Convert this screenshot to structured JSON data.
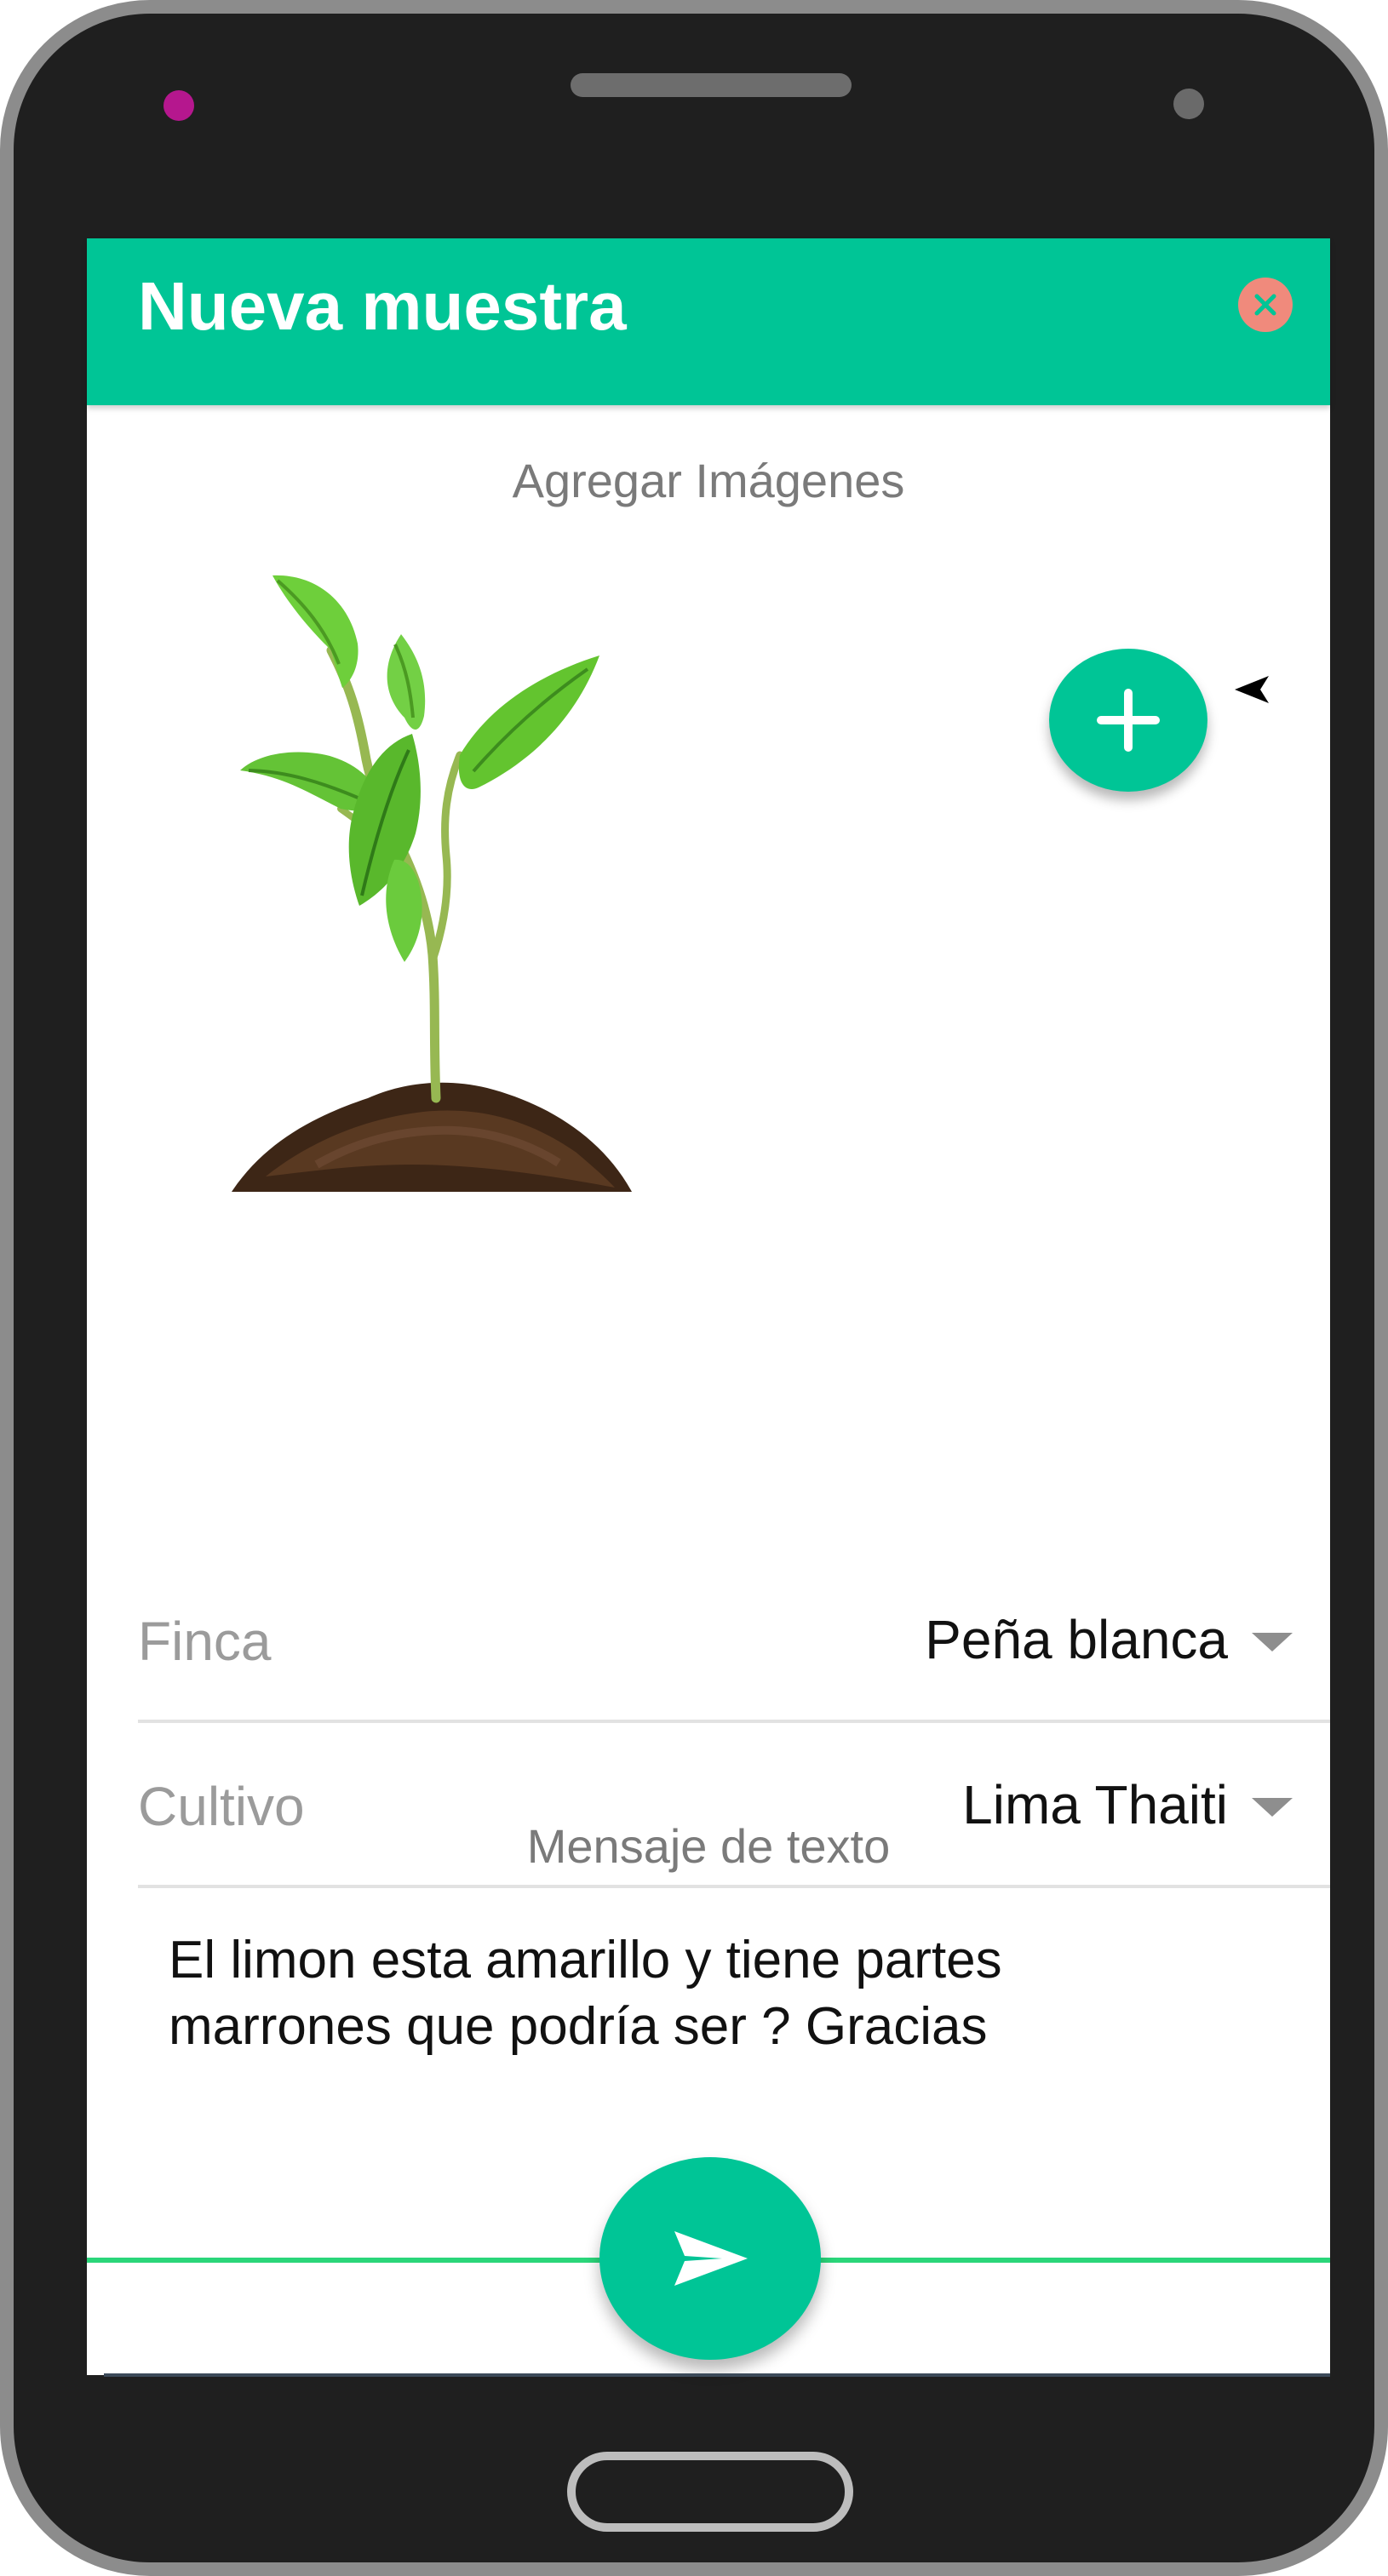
{
  "header": {
    "title": "Nueva muestra",
    "accent_color": "#00c596",
    "close_icon": "close-icon"
  },
  "images": {
    "section_label": "Agregar Imágenes",
    "add_icon": "plus-icon",
    "thumbnail_subject": "plant-photo"
  },
  "form": {
    "finca": {
      "label": "Finca",
      "value": "Peña blanca"
    },
    "cultivo": {
      "label": "Cultivo",
      "value": "Lima Thaiti"
    }
  },
  "message": {
    "section_label": "Mensaje de texto",
    "text": "El limon esta amarillo y tiene partes\nmarrones que podría ser ? Gracias",
    "send_icon": "send-icon"
  }
}
